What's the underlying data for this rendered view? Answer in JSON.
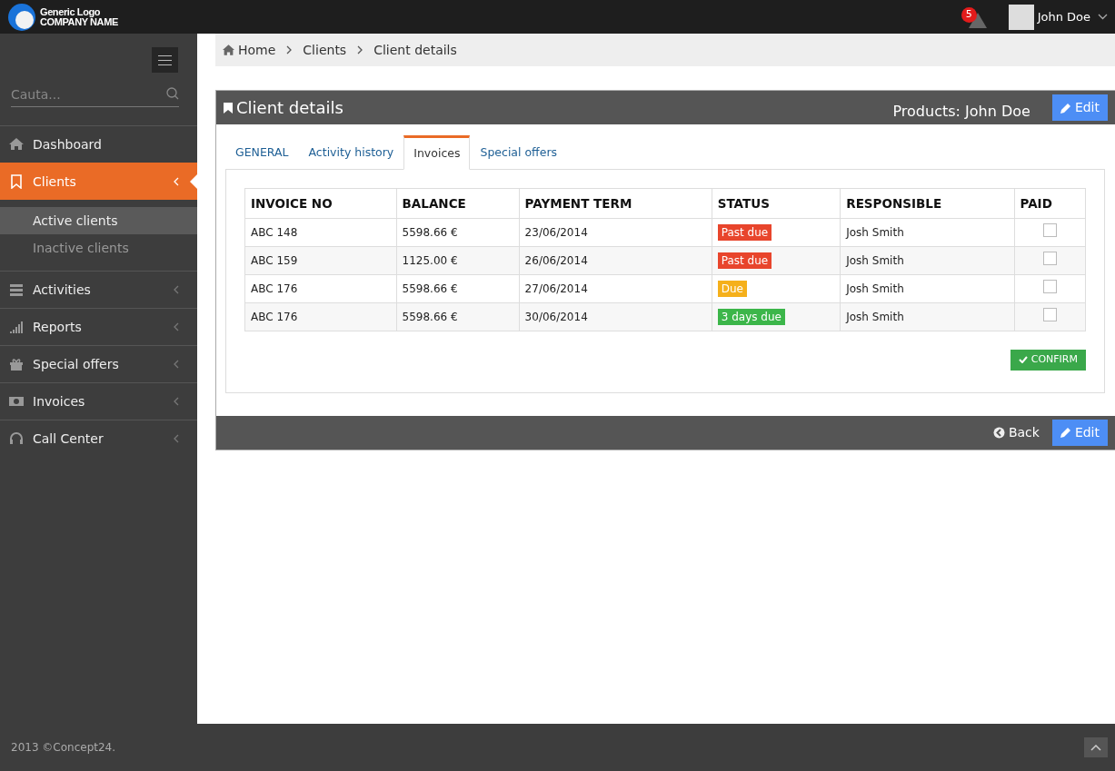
{
  "header": {
    "logo_line1": "Generic Logo",
    "logo_line2": "COMPANY NAME",
    "notification_count": "5",
    "user_name": "John Doe"
  },
  "sidebar": {
    "search_placeholder": "Cauta...",
    "items": [
      {
        "label": "Dashboard",
        "selected": false,
        "has_arrow": false
      },
      {
        "label": "Clients",
        "selected": true,
        "has_arrow": true,
        "children": [
          {
            "label": "Active clients",
            "selected": true
          },
          {
            "label": "Inactive clients",
            "selected": false
          }
        ]
      },
      {
        "label": "Activities",
        "selected": false,
        "has_arrow": true
      },
      {
        "label": "Reports",
        "selected": false,
        "has_arrow": true
      },
      {
        "label": "Special offers",
        "selected": false,
        "has_arrow": true
      },
      {
        "label": "Invoices",
        "selected": false,
        "has_arrow": true
      },
      {
        "label": "Call Center",
        "selected": false,
        "has_arrow": true
      }
    ]
  },
  "breadcrumb": [
    "Home",
    "Clients",
    "Client details"
  ],
  "panel": {
    "title": "Client details",
    "subtitle": "Products: John Doe",
    "edit_label": "Edit",
    "tabs": [
      {
        "label": "GENERAL",
        "selected": false
      },
      {
        "label": "Activity history",
        "selected": false
      },
      {
        "label": "Invoices",
        "selected": true
      },
      {
        "label": "Special offers",
        "selected": false
      }
    ],
    "table": {
      "columns": [
        "INVOICE NO",
        "BALANCE",
        "PAYMENT TERM",
        "STATUS",
        "RESPONSIBLE",
        "PAID"
      ],
      "rows": [
        {
          "invoice": "ABC 148",
          "balance": "5598.66 €",
          "term": "23/06/2014",
          "status": "Past due",
          "color": "#e8452c",
          "responsible": "Josh Smith",
          "paid": false
        },
        {
          "invoice": "ABC 159",
          "balance": "1125.00 €",
          "term": "26/06/2014",
          "status": "Past due",
          "color": "#e8452c",
          "responsible": "Josh Smith",
          "paid": false
        },
        {
          "invoice": "ABC 176",
          "balance": "5598.66 €",
          "term": "27/06/2014",
          "status": "Due",
          "color": "#f5b01b",
          "responsible": "Josh Smith",
          "paid": false
        },
        {
          "invoice": "ABC 176",
          "balance": "5598.66 €",
          "term": "30/06/2014",
          "status": "3 days due",
          "color": "#3cb64a",
          "responsible": "Josh Smith",
          "paid": false
        }
      ]
    },
    "confirm_label": "CONFIRM",
    "back_label": "Back",
    "footer_edit_label": "Edit"
  },
  "footer": {
    "copyright": "2013 ©Concept24."
  }
}
